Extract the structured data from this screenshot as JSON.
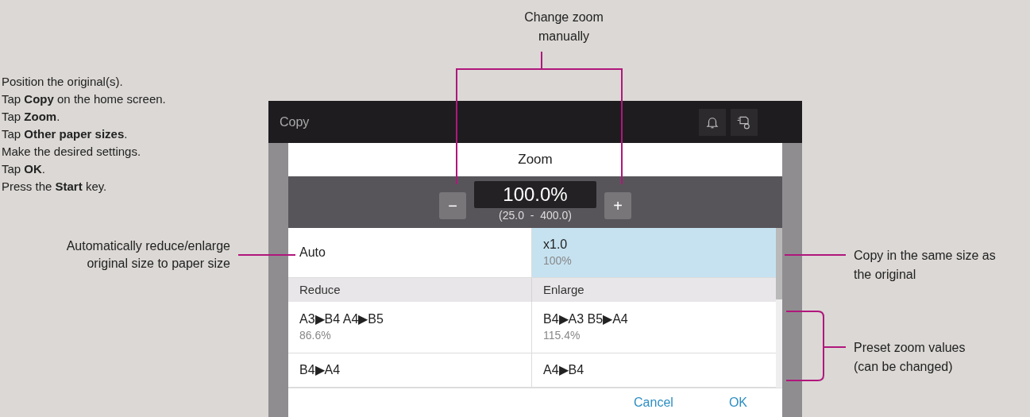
{
  "steps": [
    "Position the original(s).",
    "Tap **Copy** on the home screen.",
    "Tap **Zoom**.",
    "Tap **Other paper sizes**.",
    "Make the desired settings.",
    "Tap **OK**.",
    "Press the **Start** key."
  ],
  "callouts": {
    "change_zoom": "Change zoom\nmanually",
    "auto": "Automatically reduce/enlarge\noriginal size to paper size",
    "same_size": "Copy in the same size as\nthe original",
    "presets": "Preset zoom values\n(can be changed)"
  },
  "screen": {
    "title": "Copy",
    "dialog": {
      "title": "Zoom",
      "minus": "−",
      "plus": "+",
      "value": "100.0%",
      "range": "(25.0  -  400.0)",
      "rows": [
        {
          "kind": "option",
          "cells": [
            {
              "label": "Auto",
              "selected": false
            },
            {
              "label": "x1.0",
              "sub": "100%",
              "selected": true
            }
          ]
        },
        {
          "kind": "header",
          "cells": [
            {
              "label": "Reduce"
            },
            {
              "label": "Enlarge"
            }
          ]
        },
        {
          "kind": "option",
          "cells": [
            {
              "label": "A3▶B4  A4▶B5",
              "sub": "86.6%",
              "selected": false
            },
            {
              "label": "B4▶A3  B5▶A4",
              "sub": "115.4%",
              "selected": false
            }
          ]
        },
        {
          "kind": "option",
          "cells": [
            {
              "label": "B4▶A4",
              "selected": false
            },
            {
              "label": "A4▶B4",
              "selected": false
            }
          ]
        }
      ],
      "buttons": [
        "Cancel",
        "OK"
      ]
    }
  }
}
